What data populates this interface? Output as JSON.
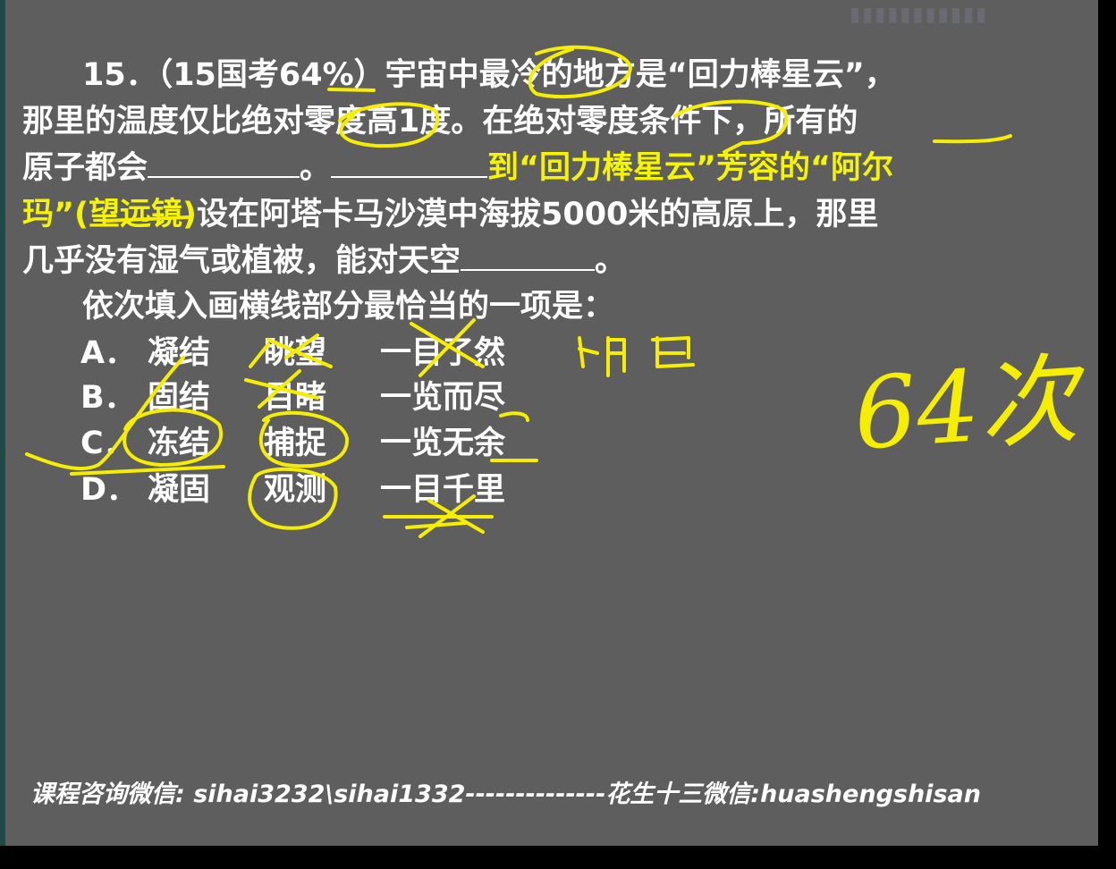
{
  "question": {
    "line1": "15．（15国考64%）宇宙中最冷的地方是“回力棒星云”，",
    "line2": "那里的温度仅比绝对零度高1度。在绝对零度条件下，所有的",
    "line3_a": "原子都会",
    "line3_b": "。",
    "line3_c": "到“回力棒星云”芳容的“阿尔",
    "line4_a": "玛”(望远镜)",
    "line4_b": "设在阿塔卡马沙漠中海拔5000米的高原上，那里",
    "line5_a": "几乎没有湿气或植被，能对天空",
    "line5_b": "。",
    "prompt": "依次填入画横线部分最恰当的一项是："
  },
  "options": [
    {
      "letter": "A．",
      "w1": "凝结",
      "w2": "眺望",
      "w3": "一目了然"
    },
    {
      "letter": "B．",
      "w1": "固结",
      "w2": "目睹",
      "w3": "一览而尽"
    },
    {
      "letter": "C．",
      "w1": "冻结",
      "w2": "捕捉",
      "w3": "一览无余"
    },
    {
      "letter": "D．",
      "w1": "凝固",
      "w2": "观测",
      "w3": "一目千里"
    }
  ],
  "handwritten_notes": [
    "明白",
    "64次"
  ],
  "footer": "课程咨询微信: sihai3232\\sihai1332--------------花生十三微信:huashengshisan",
  "colors": {
    "background": "#5e5e5e",
    "text": "#ffffff",
    "highlight": "#f5f500",
    "ink": "#f5ee00"
  }
}
